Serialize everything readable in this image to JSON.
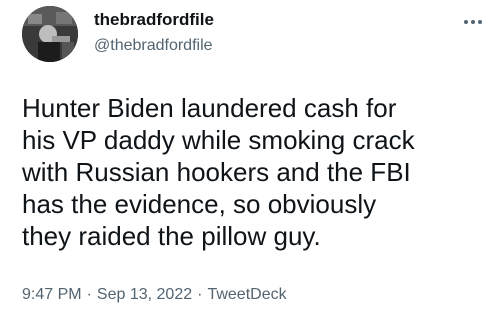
{
  "author": {
    "display_name": "thebradfordfile",
    "handle": "@thebradfordfile",
    "avatar_icon": "profile-photo"
  },
  "more_icon": "more-horizontal-icon",
  "tweet": {
    "text": "Hunter Biden laundered cash for\nhis VP daddy while smoking crack\nwith Russian hookers and the FBI\nhas the evidence, so obviously\nthey raided the pillow guy."
  },
  "meta": {
    "time": "9:47 PM",
    "separator": "·",
    "date": "Sep 13, 2022",
    "source": "TweetDeck"
  },
  "colors": {
    "text": "#0f1419",
    "secondary": "#536471",
    "background": "#ffffff"
  }
}
